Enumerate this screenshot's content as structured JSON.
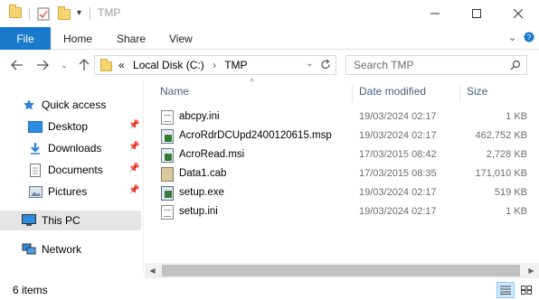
{
  "window": {
    "title": "TMP",
    "minimize_icon": "minimize-icon",
    "maximize_icon": "maximize-icon",
    "close_icon": "close-icon"
  },
  "ribbon": {
    "tabs": [
      "File",
      "Home",
      "Share",
      "View"
    ],
    "expand_icon": "chevron-down-icon",
    "help_icon": "help-icon"
  },
  "navigation": {
    "back_icon": "arrow-left-icon",
    "forward_icon": "arrow-right-icon",
    "recent_icon": "chevron-down-icon",
    "up_icon": "arrow-up-icon",
    "breadcrumbs": [
      "«",
      "Local Disk (C:)",
      "›",
      "TMP"
    ],
    "refresh_icon": "refresh-icon",
    "search_placeholder": "Search TMP"
  },
  "sidebar": {
    "items": [
      {
        "label": "Quick access",
        "icon": "star-icon",
        "pinned": false
      },
      {
        "label": "Desktop",
        "icon": "desktop-icon",
        "pinned": true
      },
      {
        "label": "Downloads",
        "icon": "download-icon",
        "pinned": true
      },
      {
        "label": "Documents",
        "icon": "documents-icon",
        "pinned": true
      },
      {
        "label": "Pictures",
        "icon": "pictures-icon",
        "pinned": true
      },
      {
        "label": "This PC",
        "icon": "computer-icon",
        "pinned": false,
        "selected": true
      },
      {
        "label": "Network",
        "icon": "network-icon",
        "pinned": false
      }
    ]
  },
  "file_list": {
    "columns": [
      "Name",
      "Date modified",
      "Size"
    ],
    "sort_icon": "sort-ascending-icon",
    "rows": [
      {
        "name": "abcpy.ini",
        "date": "19/03/2024 02:17",
        "size": "1 KB",
        "icon": "ini-file-icon"
      },
      {
        "name": "AcroRdrDCUpd2400120615.msp",
        "date": "19/03/2024 02:17",
        "size": "462,752 KB",
        "icon": "msp-file-icon"
      },
      {
        "name": "AcroRead.msi",
        "date": "17/03/2015 08:42",
        "size": "2,728 KB",
        "icon": "msi-file-icon"
      },
      {
        "name": "Data1.cab",
        "date": "17/03/2015 08:35",
        "size": "171,010 KB",
        "icon": "cab-file-icon"
      },
      {
        "name": "setup.exe",
        "date": "19/03/2024 02:17",
        "size": "519 KB",
        "icon": "exe-file-icon"
      },
      {
        "name": "setup.ini",
        "date": "19/03/2024 02:17",
        "size": "1 KB",
        "icon": "ini-file-icon"
      }
    ]
  },
  "status_bar": {
    "item_count": "6 items"
  },
  "colors": {
    "accent": "#1979ca",
    "selected_bg": "#e5e5e5",
    "header_text": "#4c607a"
  }
}
